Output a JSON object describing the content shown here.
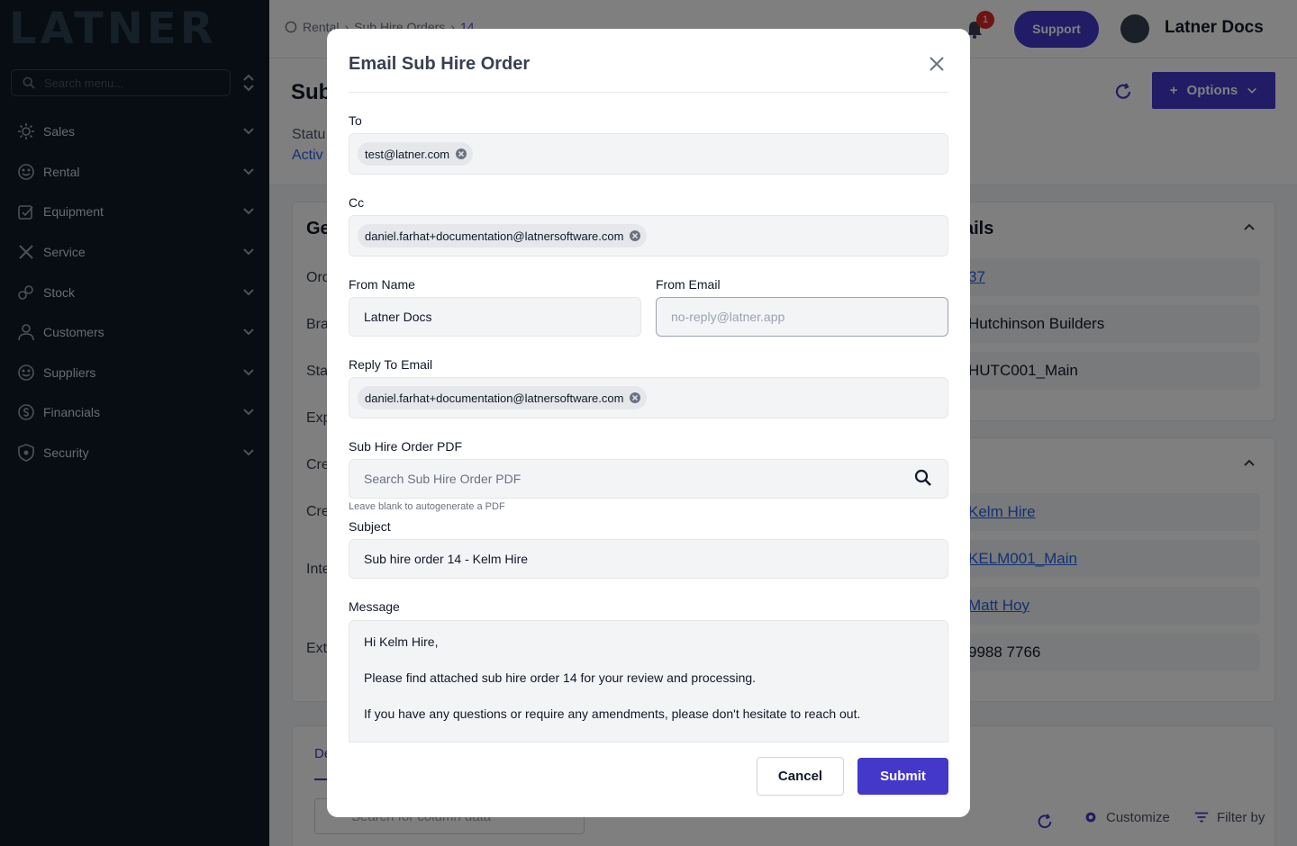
{
  "sidebar": {
    "logo": "LATNER",
    "search_placeholder": "Search menu...",
    "items": [
      {
        "label": "Sales",
        "icon": "sales-icon"
      },
      {
        "label": "Rental",
        "icon": "rental-icon"
      },
      {
        "label": "Equipment",
        "icon": "equipment-icon"
      },
      {
        "label": "Service",
        "icon": "service-icon"
      },
      {
        "label": "Stock",
        "icon": "stock-icon"
      },
      {
        "label": "Customers",
        "icon": "customers-icon"
      },
      {
        "label": "Suppliers",
        "icon": "suppliers-icon"
      },
      {
        "label": "Financials",
        "icon": "financials-icon"
      },
      {
        "label": "Security",
        "icon": "security-icon"
      }
    ]
  },
  "header": {
    "breadcrumbs": [
      "Rental",
      "Sub Hire Orders",
      "14"
    ],
    "notification_count": "1",
    "support_label": "Support",
    "user_name": "Latner Docs"
  },
  "page": {
    "title": "Sub",
    "status_label": "Statu",
    "status_value": "Activ",
    "options_label": "Options",
    "left_card_title": "Ge",
    "left_labels": [
      "Ord",
      "Bra",
      "Sta",
      "Exp",
      "Cre",
      "Cre",
      "Inte",
      "Ext"
    ],
    "right_card_title": "ails",
    "right_fields_top": [
      "37",
      "Hutchinson Builders",
      "HUTC001_Main"
    ],
    "right_fields_bottom": [
      "Kelm Hire",
      "KELM001_Main",
      "Matt Hoy",
      "9988 7766"
    ],
    "tab_active": "De",
    "column_search_placeholder": "Search for column data",
    "customize_label": "Customize",
    "filter_label": "Filter by"
  },
  "modal": {
    "title": "Email Sub Hire Order",
    "to_label": "To",
    "to_chips": [
      "test@latner.com"
    ],
    "cc_label": "Cc",
    "cc_chips": [
      "daniel.farhat+documentation@latnersoftware.com"
    ],
    "from_name_label": "From Name",
    "from_name_value": "Latner Docs",
    "from_email_label": "From Email",
    "from_email_placeholder": "no-reply@latner.app",
    "reply_to_label": "Reply To Email",
    "reply_to_chips": [
      "daniel.farhat+documentation@latnersoftware.com"
    ],
    "pdf_label": "Sub Hire Order PDF",
    "pdf_placeholder": "Search Sub Hire Order PDF",
    "pdf_hint": "Leave blank to autogenerate a PDF",
    "subject_label": "Subject",
    "subject_value": "Sub hire order 14 - Kelm Hire",
    "message_label": "Message",
    "message_lines": [
      "Hi Kelm Hire,",
      "Please find attached sub hire order 14 for your review and processing.",
      "If you have any questions or require any amendments, please don't hesitate to reach out."
    ],
    "cancel_label": "Cancel",
    "submit_label": "Submit"
  },
  "colors": {
    "sidebar_bg": "#111827",
    "primary": "#4338ca",
    "link": "#2563eb",
    "badge": "#dc2626"
  }
}
